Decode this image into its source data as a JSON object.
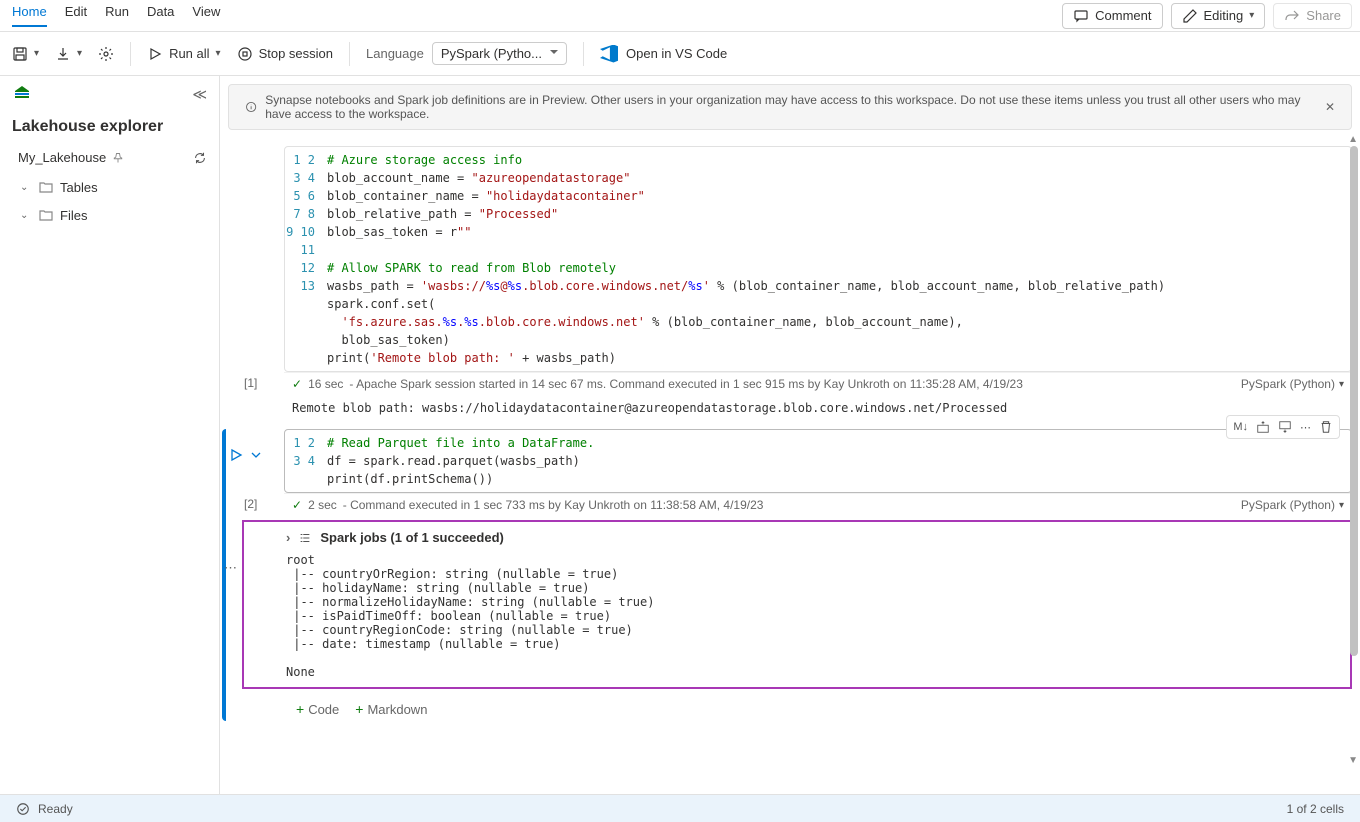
{
  "menubar": {
    "items": [
      "Home",
      "Edit",
      "Run",
      "Data",
      "View"
    ],
    "comment": "Comment",
    "editing": "Editing",
    "share": "Share"
  },
  "toolbar": {
    "runall": "Run all",
    "stop": "Stop session",
    "lang_label": "Language",
    "lang_value": "PySpark (Pytho...",
    "vscode": "Open in VS Code"
  },
  "sidebar": {
    "title": "Lakehouse explorer",
    "lakehouse": "My_Lakehouse",
    "tables": "Tables",
    "files": "Files"
  },
  "banner": {
    "text": "Synapse notebooks and Spark job definitions are in Preview. Other users in your organization may have access to this workspace. Do not use these items unless you trust all other users who may have access to the workspace."
  },
  "cells": [
    {
      "exec_label": "[1]",
      "lines": 13,
      "code_html": "<span class='c-comment'># Azure storage access info</span>\nblob_account_name = <span class='c-string'>\"azureopendatastorage\"</span>\nblob_container_name = <span class='c-string'>\"holidaydatacontainer\"</span>\nblob_relative_path = <span class='c-string'>\"Processed\"</span>\nblob_sas_token = r<span class='c-string'>\"\"</span>\n\n<span class='c-comment'># Allow SPARK to read from Blob remotely</span>\nwasbs_path = <span class='c-string'>'wasbs://<span class='c-fmt'>%s</span>@<span class='c-fmt'>%s</span>.blob.core.windows.net/<span class='c-fmt'>%s</span>'</span> % (blob_container_name, blob_account_name, blob_relative_path)\nspark.conf.set(\n  <span class='c-string'>'fs.azure.sas.<span class='c-fmt'>%s</span>.<span class='c-fmt'>%s</span>.blob.core.windows.net'</span> % (blob_container_name, blob_account_name),\n  blob_sas_token)\nprint(<span class='c-string'>'Remote blob path: '</span> + wasbs_path)\n",
      "duration": "16 sec",
      "status_text": " - Apache Spark session started in 14 sec 67 ms. Command executed in 1 sec 915 ms by Kay Unkroth on 11:35:28 AM, 4/19/23",
      "lang": "PySpark (Python)",
      "output": "Remote blob path: wasbs://holidaydatacontainer@azureopendatastorage.blob.core.windows.net/Processed"
    },
    {
      "exec_label": "[2]",
      "lines": 4,
      "code_html": "<span class='c-comment'># Read Parquet file into a DataFrame.</span>\ndf = spark.read.parquet(wasbs_path)\nprint(df.printSchema())\n",
      "duration": "2 sec",
      "status_text": " - Command executed in 1 sec 733 ms by Kay Unkroth on 11:38:58 AM, 4/19/23",
      "lang": "PySpark (Python)",
      "spark_jobs": "Spark jobs (1 of 1 succeeded)",
      "schema": "root\n |-- countryOrRegion: string (nullable = true)\n |-- holidayName: string (nullable = true)\n |-- normalizeHolidayName: string (nullable = true)\n |-- isPaidTimeOff: boolean (nullable = true)\n |-- countryRegionCode: string (nullable = true)\n |-- date: timestamp (nullable = true)\n\nNone"
    }
  ],
  "cell_toolbar": {
    "markdown": "M↓"
  },
  "add_cell": {
    "code": "Code",
    "markdown": "Markdown"
  },
  "statusbar": {
    "ready": "Ready",
    "cells": "1 of 2 cells"
  }
}
